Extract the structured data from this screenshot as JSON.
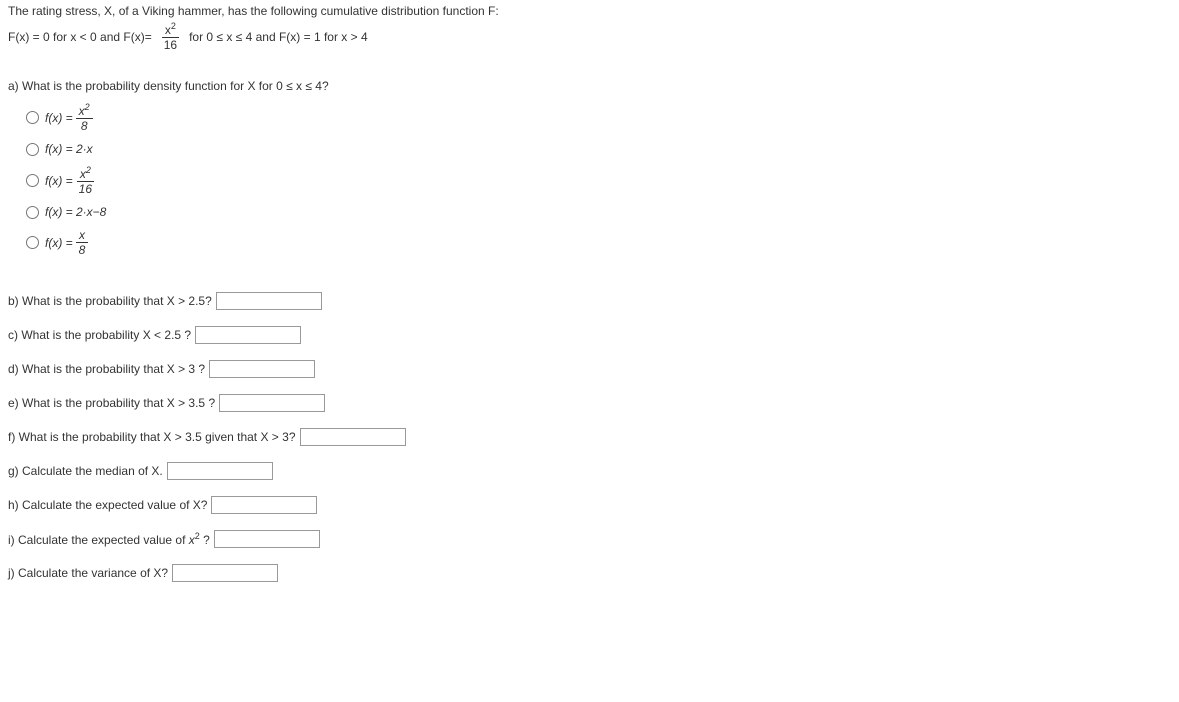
{
  "intro": {
    "line1": "The rating stress, X, of a Viking hammer, has the following cumulative distribution function F:",
    "part1": "F(x) = 0 for x < 0 and F(x)=",
    "frac_num": "x",
    "frac_sup": "2",
    "frac_den": "16",
    "part2": "for 0 ≤ x ≤ 4 and F(x) = 1 for x > 4"
  },
  "qa": {
    "prompt": "a) What is the probability density function for X for 0 ≤ x ≤ 4?",
    "options": [
      {
        "type": "frac",
        "prefix": "f(x) = ",
        "num": "x",
        "sup": "2",
        "den": "8"
      },
      {
        "type": "plain",
        "text": "f(x) = 2·x"
      },
      {
        "type": "frac",
        "prefix": "f(x) = ",
        "num": "x",
        "sup": "2",
        "den": "16"
      },
      {
        "type": "plain",
        "text": "f(x) = 2·x−8"
      },
      {
        "type": "frac",
        "prefix": "f(x) = ",
        "num": "x",
        "sup": "",
        "den": "8"
      }
    ]
  },
  "subs": {
    "b": "b) What is the probability that X > 2.5?",
    "c": "c) What is the probability X < 2.5 ?",
    "d": "d) What is the probability that X > 3 ?",
    "e": "e) What is the probability that X > 3.5 ?",
    "f": "f) What is the probability that X > 3.5 given that X > 3?",
    "g": "g) Calculate the median of X.",
    "h": "h) Calculate the expected value of X?",
    "i_pre": "i) Calculate the expected value of ",
    "i_x": "x",
    "i_sup": "2",
    "i_post": " ?",
    "j": "j) Calculate the variance of X?"
  }
}
